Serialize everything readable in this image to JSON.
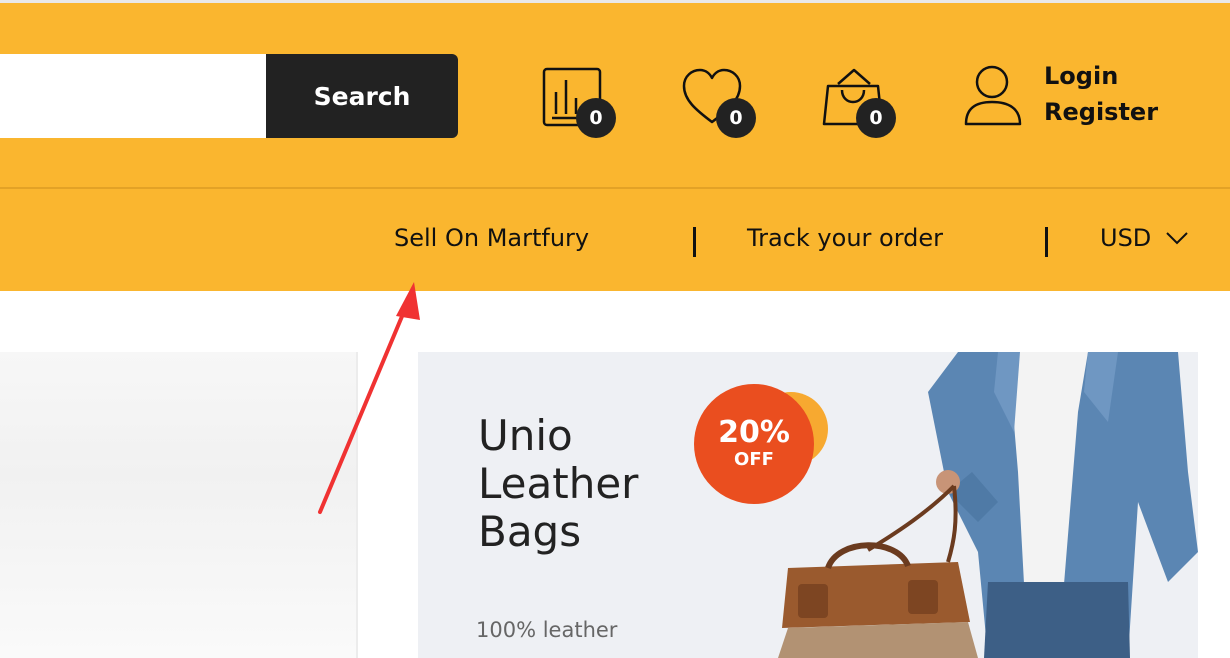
{
  "search": {
    "placeholder": "",
    "value": "",
    "button_label": "Search"
  },
  "header_actions": {
    "compare_count": "0",
    "wishlist_count": "0",
    "cart_count": "0"
  },
  "account": {
    "login_label": "Login",
    "register_label": "Register"
  },
  "nav": {
    "sell_label": "Sell On Martfury",
    "track_label": "Track your order",
    "currency_label": "USD"
  },
  "promo": {
    "title": "Unio Leather Bags",
    "discount_percent": "20%",
    "discount_off": "OFF",
    "description": "100% leather"
  },
  "colors": {
    "header_bg": "#fab62f",
    "search_button_bg": "#222222",
    "discount_badge": "#ea4e1f",
    "annotation_arrow": "#f03232"
  }
}
